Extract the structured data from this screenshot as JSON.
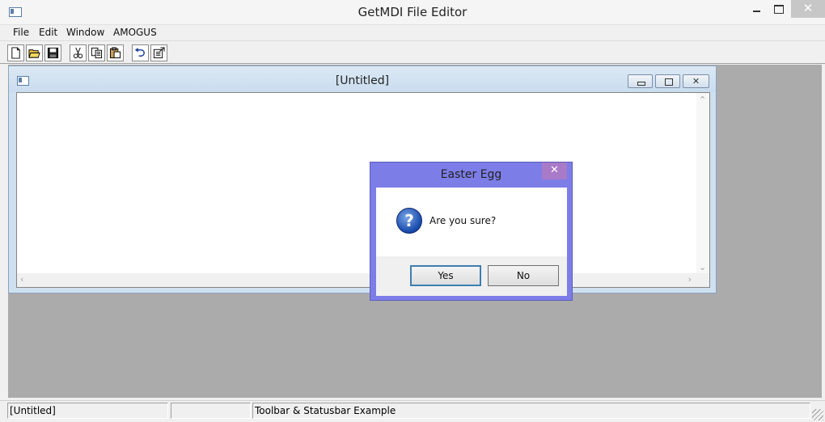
{
  "app": {
    "title": "GetMDI File Editor"
  },
  "menu": {
    "items": [
      {
        "label": "File"
      },
      {
        "label": "Edit"
      },
      {
        "label": "Window"
      },
      {
        "label": "AMOGUS"
      }
    ]
  },
  "toolbar": {
    "buttons": [
      {
        "icon": "new-file-icon"
      },
      {
        "icon": "open-folder-icon"
      },
      {
        "icon": "save-icon"
      },
      {
        "icon": "cut-icon"
      },
      {
        "icon": "copy-icon"
      },
      {
        "icon": "paste-icon"
      },
      {
        "icon": "undo-icon"
      },
      {
        "icon": "properties-icon"
      }
    ]
  },
  "child": {
    "title": "[Untitled]"
  },
  "dialog": {
    "title": "Easter Egg",
    "message": "Are you sure?",
    "icon": "question-icon",
    "yes_label": "Yes",
    "no_label": "No",
    "accent_color": "#7d7de8"
  },
  "statusbar": {
    "panels": [
      {
        "text": "[Untitled]"
      },
      {
        "text": ""
      },
      {
        "text": "Toolbar & Statusbar Example"
      }
    ]
  }
}
